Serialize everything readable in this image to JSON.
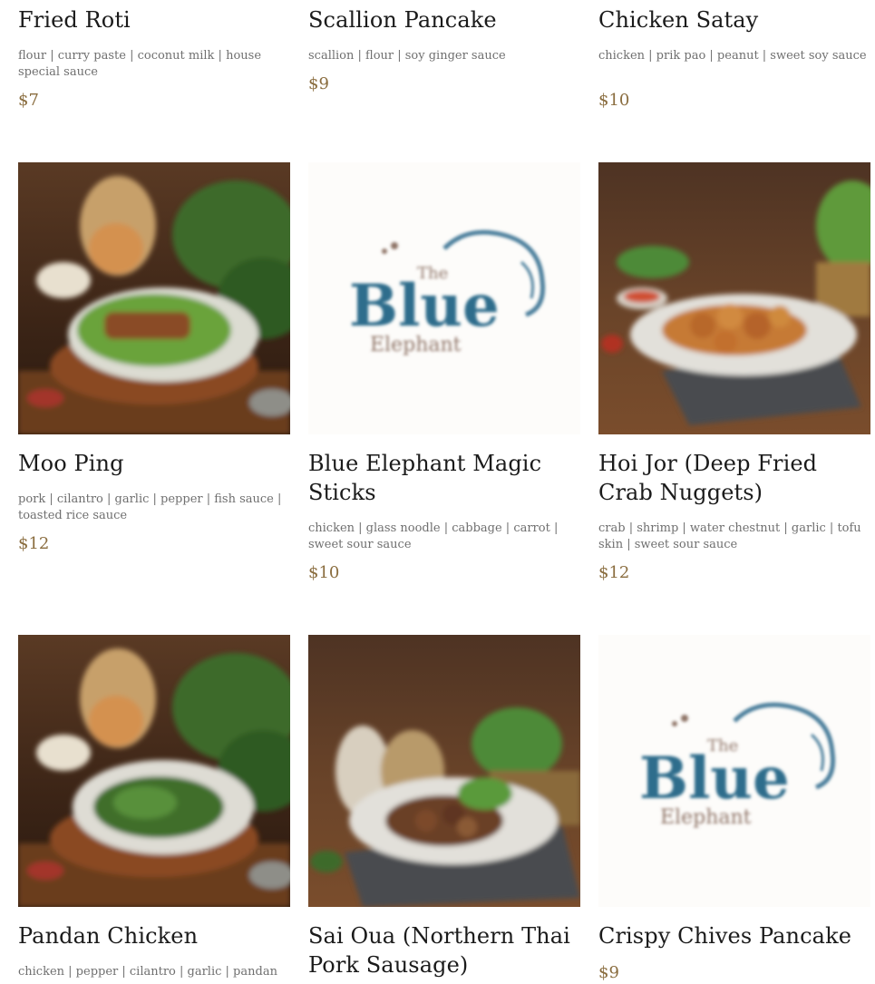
{
  "menu": {
    "items": [
      {
        "name": "Fried Roti",
        "description": "flour | curry paste | coconut milk | house special sauce",
        "price": "$7"
      },
      {
        "name": "Scallion Pancake",
        "description": "scallion | flour | soy ginger sauce",
        "price": "$9"
      },
      {
        "name": "Chicken Satay",
        "description": "chicken | prik pao | peanut | sweet soy sauce",
        "price": "$10"
      },
      {
        "name": "Moo Ping",
        "description": "pork | cilantro | garlic | pepper | fish sauce | toasted rice sauce",
        "price": "$12",
        "image": "food-photo"
      },
      {
        "name": "Blue Elephant Magic Sticks",
        "description": "chicken | glass noodle | cabbage | carrot | sweet sour sauce",
        "price": "$10",
        "image": "logo-placeholder"
      },
      {
        "name": "Hoi Jor (Deep Fried Crab Nuggets)",
        "description": "crab | shrimp | water chestnut | garlic | tofu skin | sweet sour sauce",
        "price": "$12",
        "image": "food-photo"
      },
      {
        "name": "Pandan Chicken",
        "description": "chicken | pepper | cilantro | garlic | pandan",
        "image": "food-photo"
      },
      {
        "name": "Sai Oua (Northern Thai Pork Sausage)",
        "image": "food-photo"
      },
      {
        "name": "Crispy Chives Pancake",
        "price": "$9",
        "image": "logo-placeholder"
      }
    ]
  },
  "logo": {
    "line1": "The",
    "line2": "Blue",
    "line3": "Elephant"
  },
  "colors": {
    "price": "#8a6d3f",
    "logo_blue": "#2f6d8c",
    "logo_brown": "#8f7468",
    "wood": "#4a2f1d"
  }
}
